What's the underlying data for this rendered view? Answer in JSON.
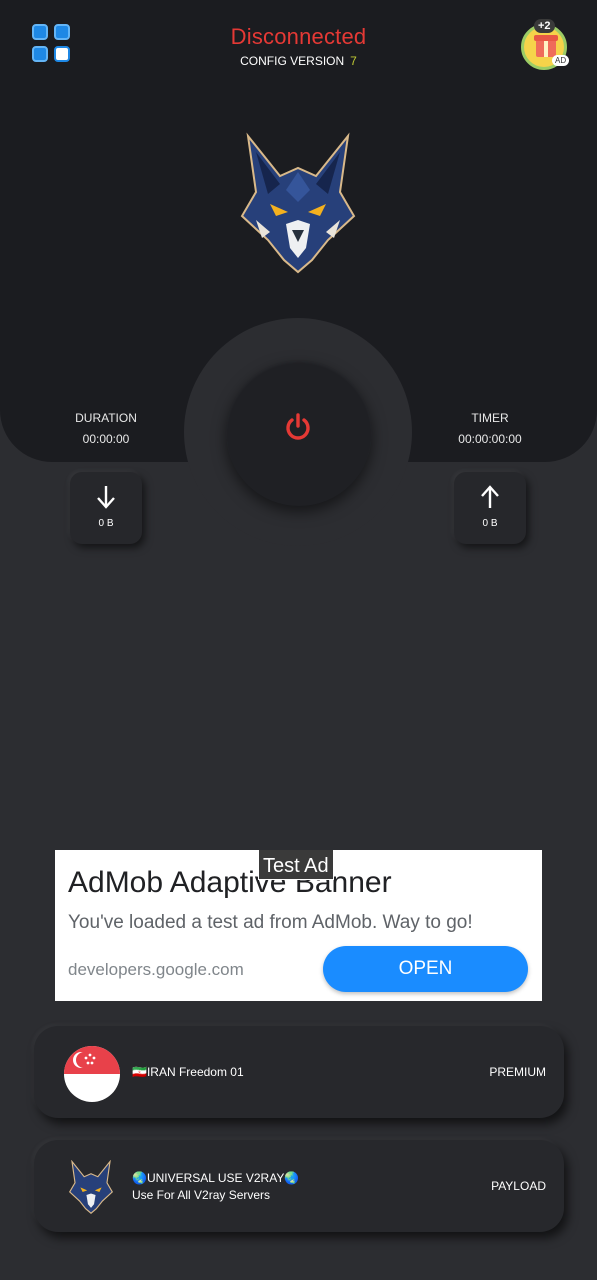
{
  "header": {
    "status": "Disconnected",
    "config_label": "CONFIG VERSION",
    "config_version": "7",
    "reward_badge": "+2",
    "reward_ad_tag": "AD"
  },
  "stats": {
    "duration_label": "DURATION",
    "duration_value": "00:00:00",
    "timer_label": "TIMER",
    "timer_value": "00:00:00:00",
    "download_value": "0 B",
    "upload_value": "0 B"
  },
  "ad": {
    "tag": "Test Ad",
    "title": "AdMob Adaptive Banner",
    "subtitle": "You've loaded a test ad from AdMob. Way to go!",
    "domain": "developers.google.com",
    "button": "OPEN"
  },
  "servers": [
    {
      "name": "🇮🇷IRAN Freedom 01",
      "subtitle": "",
      "type": "PREMIUM",
      "icon": "singapore-flag-icon"
    },
    {
      "name": "🌏UNIVERSAL USE V2RAY🌏",
      "subtitle": "Use For All V2ray Servers",
      "type": "PAYLOAD",
      "icon": "wolf-icon"
    }
  ],
  "colors": {
    "status_red": "#e53935",
    "version_yellow": "#c0ca33",
    "panel": "#1b1c20",
    "background": "#2c2d31",
    "open_button": "#1a8cff"
  }
}
